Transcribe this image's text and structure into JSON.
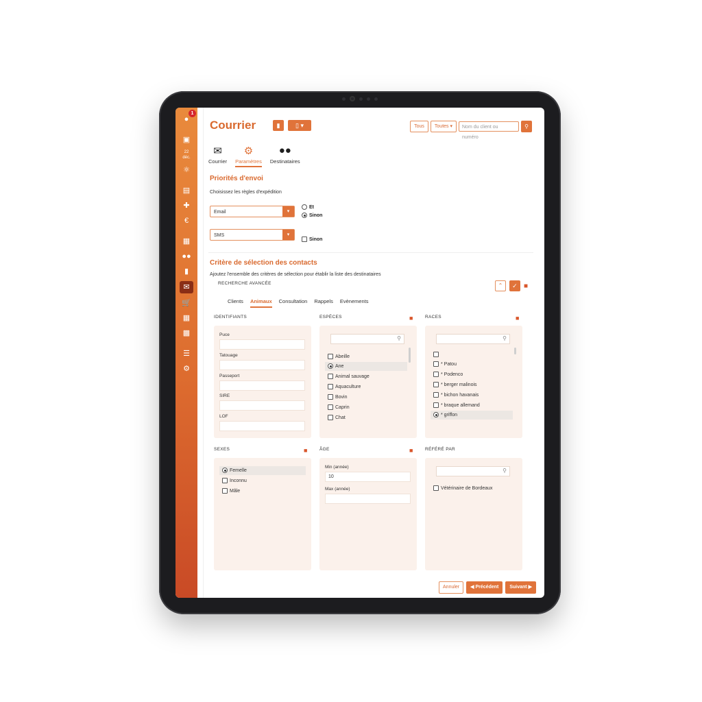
{
  "sidebar": {
    "badge_count": "1",
    "icons": [
      "user-icon",
      "dashboard-icon",
      "calendar-icon",
      "syringe-icon",
      "document-icon",
      "medical-plus-icon",
      "euro-icon",
      "building-icon",
      "users-icon",
      "bottle-icon",
      "mail-icon",
      "cart-icon",
      "calculator-icon",
      "bar-chart-icon",
      "list-icon",
      "gear-icon"
    ],
    "calendar_day": "22",
    "calendar_month": "déc."
  },
  "header": {
    "title": "Courrier",
    "btn_all": "Tous",
    "select_all": "Toutes",
    "search_placeholder": "Nom du client ou numéro"
  },
  "tabs": [
    {
      "label": "Courrier",
      "icon": "envelope-icon"
    },
    {
      "label": "Paramètres",
      "icon": "gear-icon"
    },
    {
      "label": "Destinataires",
      "icon": "users-icon"
    }
  ],
  "priorities": {
    "title": "Priorités d'envoi",
    "subtitle": "Choisissez les règles d'expédition",
    "select1": "Email",
    "select2": "SMS",
    "opt_et": "Et",
    "opt_sinon": "Sinon",
    "opt_sinon2": "Sinon"
  },
  "criteria": {
    "title": "Critère de sélection des contacts",
    "subtitle": "Ajoutez l'ensemble des critères de sélection pour établir la liste des destinataires",
    "adv_title": "RECHERCHE AVANCÉE",
    "subtabs": [
      "Clients",
      "Animaux",
      "Consultation",
      "Rappels",
      "Evènements"
    ]
  },
  "panels": {
    "identifiants": {
      "title": "IDENTIFIANTS",
      "fields": [
        "Puce",
        "Tatouage",
        "Passeport",
        "SIRE",
        "LOF"
      ]
    },
    "especes": {
      "title": "ESPÈCES",
      "items": [
        "Abeille",
        "Ane",
        "Animal sauvage",
        "Aquaculture",
        "Bovin",
        "Caprin",
        "Chat"
      ]
    },
    "races": {
      "title": "RACES",
      "items": [
        "",
        "* Patou",
        "* Podenco",
        "* berger malinois",
        "* bichon havanais",
        "* braque allemand",
        "* griffon"
      ]
    },
    "sexes": {
      "title": "SEXES",
      "items": [
        "Femelle",
        "Inconnu",
        "Mâle"
      ]
    },
    "age": {
      "title": "ÂGE",
      "min_label": "Min (année)",
      "min_value": "10",
      "max_label": "Max (année)"
    },
    "refere": {
      "title": "RÉFÉRÉ PAR",
      "items": [
        "Vétérinaire de Bordeaux"
      ]
    }
  },
  "footer": {
    "cancel": "Annuler",
    "prev": "Précédent",
    "next": "Suivant"
  }
}
